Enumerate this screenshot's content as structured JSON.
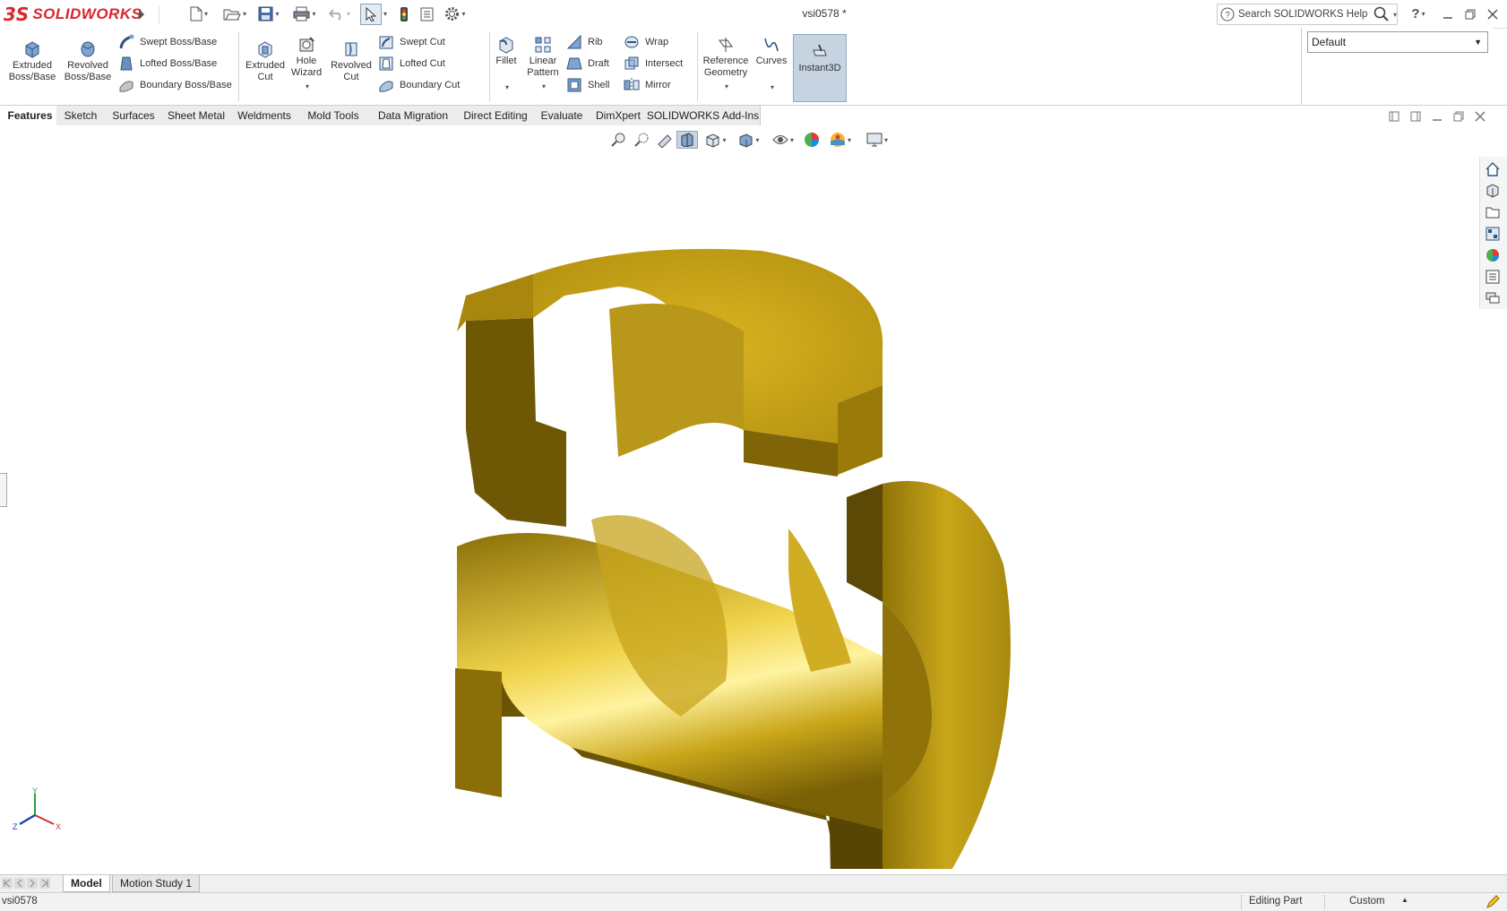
{
  "app": {
    "brand_ds": "3S",
    "brand_name": "SOLIDWORKS",
    "doc_title": "vsi0578 *"
  },
  "search": {
    "placeholder": "Search SOLIDWORKS Help"
  },
  "quick_access": {
    "icons": [
      "new-document-icon",
      "open-folder-icon",
      "save-icon",
      "print-icon",
      "undo-icon",
      "select-arrow-icon",
      "rebuild-icon",
      "file-properties-icon",
      "options-gear-icon"
    ]
  },
  "features": {
    "extruded_boss": "Extruded\nBoss/Base",
    "revolved_boss": "Revolved\nBoss/Base",
    "swept_boss": "Swept Boss/Base",
    "lofted_boss": "Lofted Boss/Base",
    "boundary_boss": "Boundary Boss/Base",
    "extruded_cut": "Extruded\nCut",
    "hole_wizard": "Hole\nWizard",
    "revolved_cut": "Revolved\nCut",
    "swept_cut": "Swept Cut",
    "lofted_cut": "Lofted Cut",
    "boundary_cut": "Boundary Cut",
    "fillet": "Fillet",
    "linear_pattern": "Linear\nPattern",
    "rib": "Rib",
    "draft": "Draft",
    "shell": "Shell",
    "wrap": "Wrap",
    "intersect": "Intersect",
    "mirror": "Mirror",
    "reference_geometry": "Reference\nGeometry",
    "curves": "Curves",
    "instant3d": "Instant3D"
  },
  "config": {
    "selected": "Default"
  },
  "tabs": [
    "Features",
    "Sketch",
    "Surfaces",
    "Sheet Metal",
    "Weldments",
    "Mold Tools",
    "Data Migration",
    "Direct Editing",
    "Evaluate",
    "DimXpert",
    "SOLIDWORKS Add-Ins"
  ],
  "active_tab": "Features",
  "triad": {
    "x": "X",
    "y": "Y",
    "z": "Z"
  },
  "bottom_tabs": [
    "Model",
    "Motion Study 1"
  ],
  "status": {
    "left": "vsi0578",
    "mode": "Editing Part",
    "units": "Custom"
  },
  "colors": {
    "brand_red": "#d9262c",
    "part_gold": "#c9a619",
    "instant3d_active": "#c6d4e2"
  }
}
